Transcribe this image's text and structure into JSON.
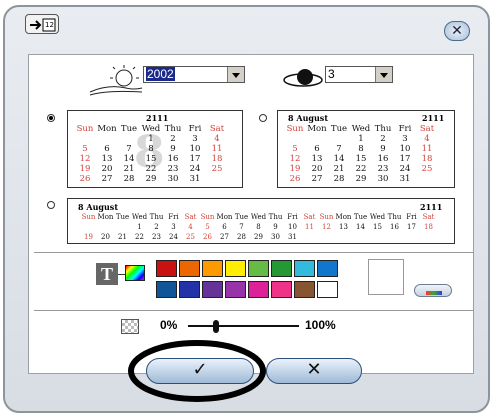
{
  "title_icon": "calendar-icon",
  "close_icon": "close-icon",
  "close_label": "✕",
  "year_combo": {
    "icon": "sun-icon",
    "value": "2002"
  },
  "month_combo": {
    "icon": "globe-icon",
    "value": "3"
  },
  "calendar_small": {
    "year": "2111",
    "month_num": "8",
    "weekdays": [
      "Sun",
      "Mon",
      "Tue",
      "Wed",
      "Thu",
      "Fri",
      "Sat"
    ],
    "rows": [
      [
        "",
        "",
        "",
        "1",
        "2",
        "3",
        "4"
      ],
      [
        "5",
        "6",
        "7",
        "8",
        "9",
        "10",
        "11"
      ],
      [
        "12",
        "13",
        "14",
        "15",
        "16",
        "17",
        "18"
      ],
      [
        "19",
        "20",
        "21",
        "22",
        "23",
        "24",
        "25"
      ],
      [
        "26",
        "27",
        "28",
        "29",
        "30",
        "31",
        ""
      ]
    ]
  },
  "calendar_small_2": {
    "year": "2111",
    "month_num": "8",
    "month_name": "August",
    "weekdays": [
      "Sun",
      "Mon",
      "Tue",
      "Wed",
      "Thu",
      "Fri",
      "Sat"
    ],
    "rows": [
      [
        "",
        "",
        "",
        "1",
        "2",
        "3",
        "4"
      ],
      [
        "5",
        "6",
        "7",
        "8",
        "9",
        "10",
        "11"
      ],
      [
        "12",
        "13",
        "14",
        "15",
        "16",
        "17",
        "18"
      ],
      [
        "19",
        "20",
        "21",
        "22",
        "23",
        "24",
        "25"
      ],
      [
        "26",
        "27",
        "28",
        "29",
        "30",
        "31",
        ""
      ]
    ]
  },
  "calendar_wide": {
    "month_num": "8",
    "month_name": "August",
    "year": "2111",
    "row1": [
      "Sun",
      "Mon",
      "Tue",
      "Wed",
      "Thu",
      "Fri",
      "Sat",
      "Sun",
      "Mon",
      "Tue",
      "Wed",
      "Thu",
      "Fri",
      "Sat",
      "Sun",
      "Mon",
      "Tue",
      "Wed",
      "Thu",
      "Fri",
      "Sat"
    ],
    "row2": [
      "",
      "",
      "",
      "1",
      "2",
      "3",
      "4",
      "5",
      "6",
      "7",
      "8",
      "9",
      "10",
      "11",
      "12",
      "13",
      "14",
      "15",
      "16",
      "17",
      "18"
    ],
    "row3": [
      "19",
      "20",
      "21",
      "22",
      "23",
      "24",
      "25",
      "26",
      "27",
      "28",
      "29",
      "30",
      "31",
      "",
      "",
      "",
      "",
      "",
      "",
      "",
      ""
    ]
  },
  "text_icon_label": "T",
  "colors": [
    "#cc1111",
    "#ee6600",
    "#ff9900",
    "#ffee00",
    "#66bb44",
    "#229933",
    "#33bbdd",
    "#1177cc",
    "#115599",
    "#2233aa",
    "#663399",
    "#9933aa",
    "#dd2299",
    "#ee3388",
    "#885533",
    "#ffffff"
  ],
  "opacity": {
    "min_label": "0%",
    "max_label": "100%",
    "level": 0.25
  },
  "ok_label": "✓",
  "cancel_label": "✕"
}
